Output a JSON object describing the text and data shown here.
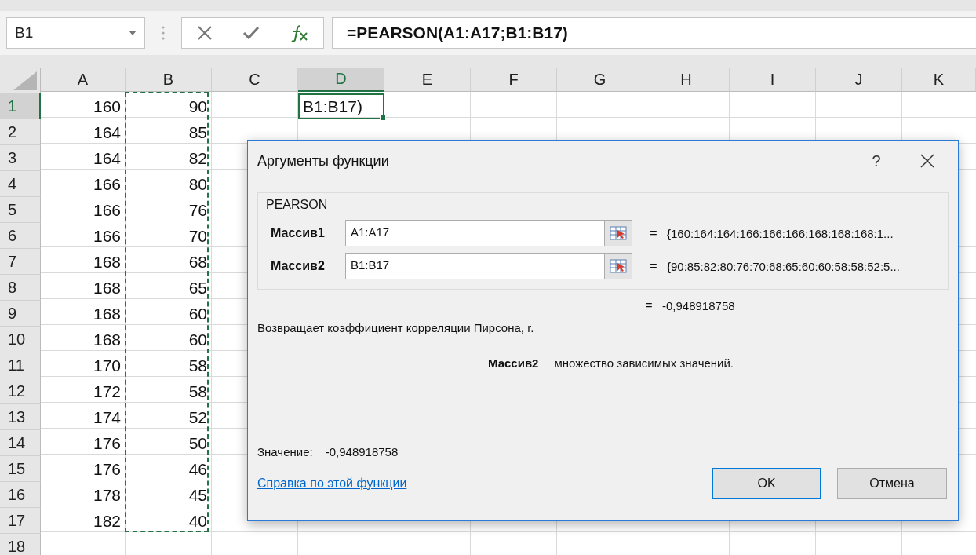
{
  "name_box": {
    "value": "B1"
  },
  "formula_bar": {
    "formula": "=PEARSON(A1:A17;B1:B17)"
  },
  "columns": [
    {
      "label": "A",
      "selected": false
    },
    {
      "label": "B",
      "selected": false
    },
    {
      "label": "C",
      "selected": false
    },
    {
      "label": "D",
      "selected": true
    },
    {
      "label": "E",
      "selected": false
    },
    {
      "label": "F",
      "selected": false
    },
    {
      "label": "G",
      "selected": false
    },
    {
      "label": "H",
      "selected": false
    },
    {
      "label": "I",
      "selected": false
    },
    {
      "label": "J",
      "selected": false
    },
    {
      "label": "K",
      "selected": false
    }
  ],
  "rows": [
    {
      "header": "1",
      "selected": true,
      "a": "160",
      "b": "90",
      "d": "B1:B17)"
    },
    {
      "header": "2",
      "selected": false,
      "a": "164",
      "b": "85"
    },
    {
      "header": "3",
      "selected": false,
      "a": "164",
      "b": "82"
    },
    {
      "header": "4",
      "selected": false,
      "a": "166",
      "b": "80"
    },
    {
      "header": "5",
      "selected": false,
      "a": "166",
      "b": "76"
    },
    {
      "header": "6",
      "selected": false,
      "a": "166",
      "b": "70"
    },
    {
      "header": "7",
      "selected": false,
      "a": "168",
      "b": "68"
    },
    {
      "header": "8",
      "selected": false,
      "a": "168",
      "b": "65"
    },
    {
      "header": "9",
      "selected": false,
      "a": "168",
      "b": "60"
    },
    {
      "header": "10",
      "selected": false,
      "a": "168",
      "b": "60"
    },
    {
      "header": "11",
      "selected": false,
      "a": "170",
      "b": "58"
    },
    {
      "header": "12",
      "selected": false,
      "a": "172",
      "b": "58"
    },
    {
      "header": "13",
      "selected": false,
      "a": "174",
      "b": "52"
    },
    {
      "header": "14",
      "selected": false,
      "a": "176",
      "b": "50"
    },
    {
      "header": "15",
      "selected": false,
      "a": "176",
      "b": "46"
    },
    {
      "header": "16",
      "selected": false,
      "a": "178",
      "b": "45"
    },
    {
      "header": "17",
      "selected": false,
      "a": "182",
      "b": "40"
    },
    {
      "header": "18",
      "selected": false
    }
  ],
  "dialog": {
    "title": "Аргументы функции",
    "help": "?",
    "group": "PEARSON",
    "arguments": [
      {
        "label": "Массив1",
        "value": "A1:A17",
        "equals": "=",
        "result": "{160:164:164:166:166:166:168:168:168:1..."
      },
      {
        "label": "Массив2",
        "value": "B1:B17",
        "equals": "=",
        "result": "{90:85:82:80:76:70:68:65:60:60:58:58:52:5..."
      }
    ],
    "result_equals": "=",
    "result": "-0,948918758",
    "description": "Возвращает коэффициент корреляции Пирсона, r.",
    "argument_help": {
      "name": "Массив2",
      "text": "множество зависимых значений."
    },
    "value_label": "Значение:",
    "value": "-0,948918758",
    "help_link": "Справка по этой функции",
    "buttons": [
      {
        "label": "OK",
        "selected": true
      },
      {
        "label": "Отмена",
        "selected": false
      }
    ]
  }
}
